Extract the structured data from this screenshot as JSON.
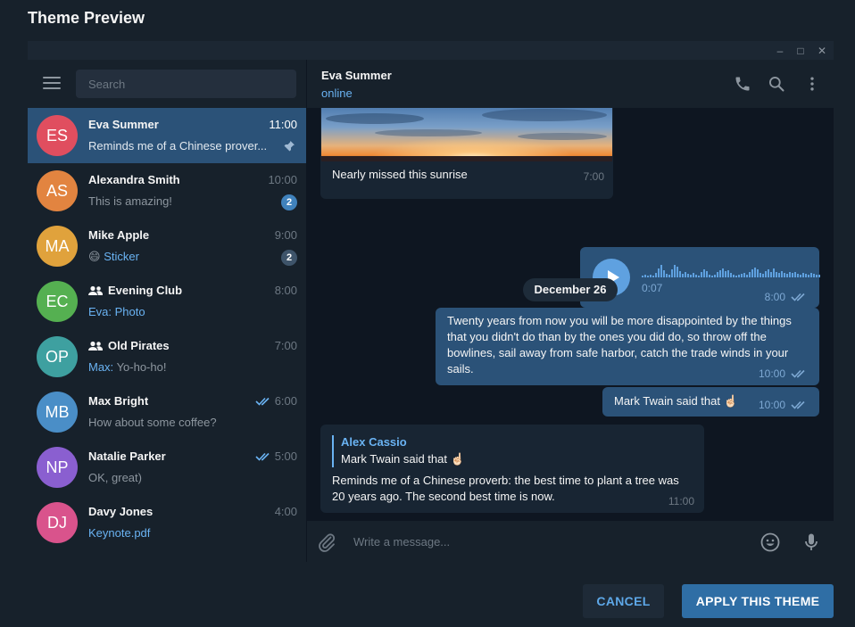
{
  "dialog": {
    "title": "Theme Preview",
    "cancel_label": "CANCEL",
    "apply_label": "APPLY THIS THEME"
  },
  "window_controls": {
    "minimize": "–",
    "maximize": "□",
    "close": "✕"
  },
  "sidebar": {
    "search_placeholder": "Search",
    "chats": [
      {
        "initials": "ES",
        "name": "Eva Summer",
        "time": "11:00",
        "preview": "Reminds me of a Chinese prover...",
        "avatar_color": "#e04e5f",
        "active": true,
        "pinned": true
      },
      {
        "initials": "AS",
        "name": "Alexandra Smith",
        "time": "10:00",
        "preview": "This is amazing!",
        "avatar_color": "#e28440",
        "badge": "2"
      },
      {
        "initials": "MA",
        "name": "Mike Apple",
        "time": "9:00",
        "preview_emoji": "😄",
        "preview": "Sticker",
        "avatar_color": "#e0a23c",
        "badge": "2",
        "badge_muted": true
      },
      {
        "initials": "EC",
        "name": "Evening Club",
        "time": "8:00",
        "preview": "Eva: Photo",
        "avatar_color": "#55b051",
        "group": true
      },
      {
        "initials": "OP",
        "name": "Old Pirates",
        "time": "7:00",
        "preview_sender": "Max:",
        "preview": "Yo-ho-ho!",
        "avatar_color": "#3ea0a0",
        "group": true
      },
      {
        "initials": "MB",
        "name": "Max Bright",
        "time": "6:00",
        "preview": "How about some coffee?",
        "avatar_color": "#4a8ec7",
        "read": true
      },
      {
        "initials": "NP",
        "name": "Natalie Parker",
        "time": "5:00",
        "preview": "OK, great)",
        "avatar_color": "#8a5fd0",
        "read": true
      },
      {
        "initials": "DJ",
        "name": "Davy Jones",
        "time": "4:00",
        "preview": "Keynote.pdf",
        "avatar_color": "#d9538c"
      }
    ]
  },
  "chat": {
    "name": "Eva Summer",
    "status": "online",
    "photo_caption": "Nearly missed this sunrise",
    "photo_time": "7:00",
    "voice_duration": "0:07",
    "voice_time": "8:00",
    "date_separator": "December 26",
    "quote_text": "Twenty years from now you will be more disappointed by the things that you didn't do than by the ones you did do, so throw off the bowlines, sail away from safe harbor, catch the trade winds in your sails.",
    "quote_time": "10:00",
    "twain_text": "Mark Twain said that ☝🏻",
    "twain_time": "10:00",
    "reply_author": "Alex Cassio",
    "reply_quote": "Mark Twain said that ☝🏻",
    "reply_text": "Reminds me of a Chinese proverb: the best time to plant a tree was 20 years ago. The second best time is now.",
    "reply_time": "11:00",
    "composer_placeholder": "Write a message..."
  },
  "colors": {
    "accent": "#6ab3f3",
    "outgoing_bubble": "#2b5278",
    "incoming_bubble": "#182533",
    "background": "#0e1621",
    "panel": "#17212b"
  }
}
